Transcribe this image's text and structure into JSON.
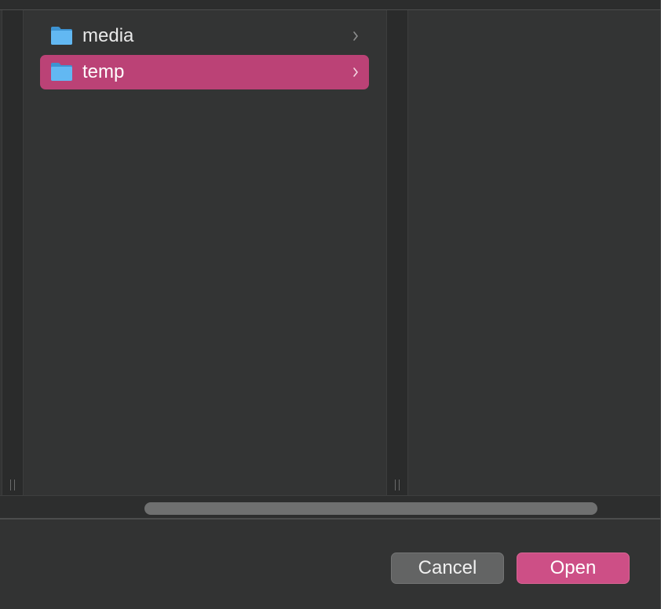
{
  "browser": {
    "column1": {
      "items": [
        {
          "label": "media",
          "icon": "folder-icon",
          "selected": false
        },
        {
          "label": "temp",
          "icon": "folder-icon",
          "selected": true
        }
      ]
    }
  },
  "footer": {
    "cancel_label": "Cancel",
    "open_label": "Open"
  },
  "colors": {
    "selection": "#bb4276",
    "primary_button": "#cd4f86",
    "folder_blue": "#5cb4ef"
  }
}
